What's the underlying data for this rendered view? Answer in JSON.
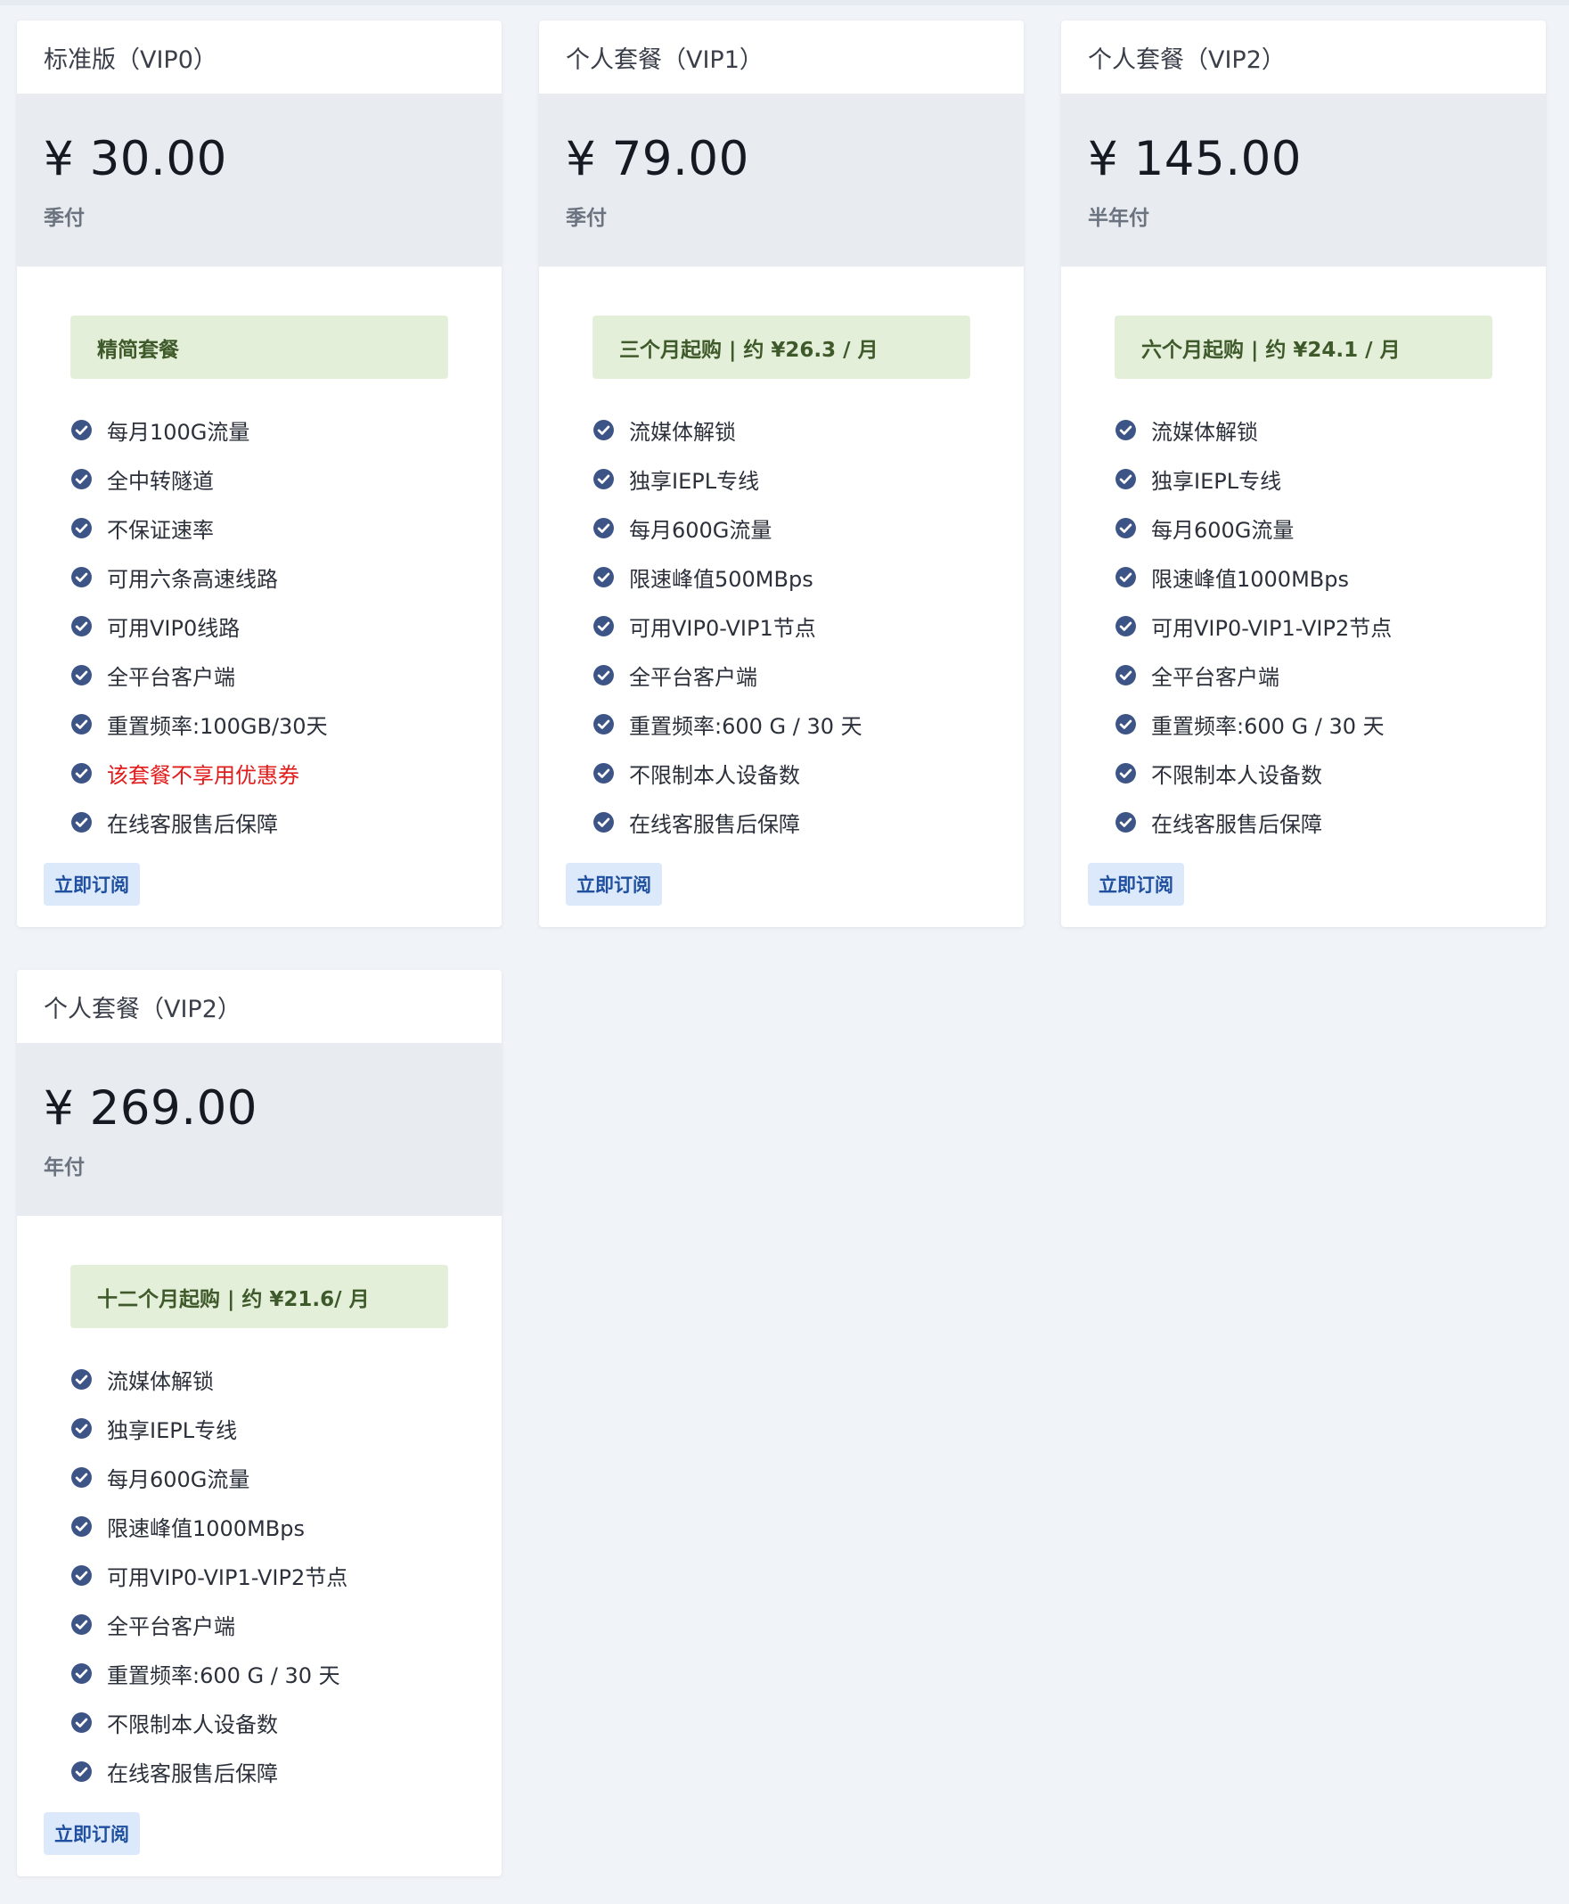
{
  "plans": [
    {
      "title": "标准版（VIP0）",
      "price": "¥ 30.00",
      "period": "季付",
      "banner": "精简套餐",
      "features": [
        {
          "text": "每月100G流量",
          "warn": false
        },
        {
          "text": "全中转隧道",
          "warn": false
        },
        {
          "text": "不保证速率",
          "warn": false
        },
        {
          "text": "可用六条高速线路",
          "warn": false
        },
        {
          "text": "可用VIP0线路",
          "warn": false
        },
        {
          "text": "全平台客户端",
          "warn": false
        },
        {
          "text": "重置频率:100GB/30天",
          "warn": false
        },
        {
          "text": "该套餐不享用优惠券",
          "warn": true
        },
        {
          "text": "在线客服售后保障",
          "warn": false
        }
      ],
      "button": "立即订阅"
    },
    {
      "title": "个人套餐（VIP1）",
      "price": "¥ 79.00",
      "period": "季付",
      "banner": "三个月起购 | 约 ¥26.3 / 月",
      "features": [
        {
          "text": "流媒体解锁",
          "warn": false
        },
        {
          "text": "独享IEPL专线",
          "warn": false
        },
        {
          "text": "每月600G流量",
          "warn": false
        },
        {
          "text": "限速峰值500MBps",
          "warn": false
        },
        {
          "text": "可用VIP0-VIP1节点",
          "warn": false
        },
        {
          "text": "全平台客户端",
          "warn": false
        },
        {
          "text": "重置频率:600 G / 30 天",
          "warn": false
        },
        {
          "text": "不限制本人设备数",
          "warn": false
        },
        {
          "text": "在线客服售后保障",
          "warn": false
        }
      ],
      "button": "立即订阅"
    },
    {
      "title": "个人套餐（VIP2）",
      "price": "¥ 145.00",
      "period": "半年付",
      "banner": "六个月起购 | 约 ¥24.1 / 月",
      "features": [
        {
          "text": "流媒体解锁",
          "warn": false
        },
        {
          "text": "独享IEPL专线",
          "warn": false
        },
        {
          "text": "每月600G流量",
          "warn": false
        },
        {
          "text": "限速峰值1000MBps",
          "warn": false
        },
        {
          "text": "可用VIP0-VIP1-VIP2节点",
          "warn": false
        },
        {
          "text": "全平台客户端",
          "warn": false
        },
        {
          "text": "重置频率:600 G / 30 天",
          "warn": false
        },
        {
          "text": "不限制本人设备数",
          "warn": false
        },
        {
          "text": "在线客服售后保障",
          "warn": false
        }
      ],
      "button": "立即订阅"
    },
    {
      "title": "个人套餐（VIP2）",
      "price": "¥ 269.00",
      "period": "年付",
      "banner": "十二个月起购 | 约 ¥21.6/ 月",
      "features": [
        {
          "text": "流媒体解锁",
          "warn": false
        },
        {
          "text": "独享IEPL专线",
          "warn": false
        },
        {
          "text": "每月600G流量",
          "warn": false
        },
        {
          "text": "限速峰值1000MBps",
          "warn": false
        },
        {
          "text": "可用VIP0-VIP1-VIP2节点",
          "warn": false
        },
        {
          "text": "全平台客户端",
          "warn": false
        },
        {
          "text": "重置频率:600 G / 30 天",
          "warn": false
        },
        {
          "text": "不限制本人设备数",
          "warn": false
        },
        {
          "text": "在线客服售后保障",
          "warn": false
        }
      ],
      "button": "立即订阅"
    }
  ],
  "colors": {
    "check_icon": "#3d5487",
    "warn_text": "#e21b1b",
    "banner_bg": "#e4efda",
    "button_bg": "#dbe9fb",
    "button_text": "#1f4f9e",
    "price_bg": "#e8ebef"
  },
  "icons": {
    "feature": "check-circle-icon"
  }
}
